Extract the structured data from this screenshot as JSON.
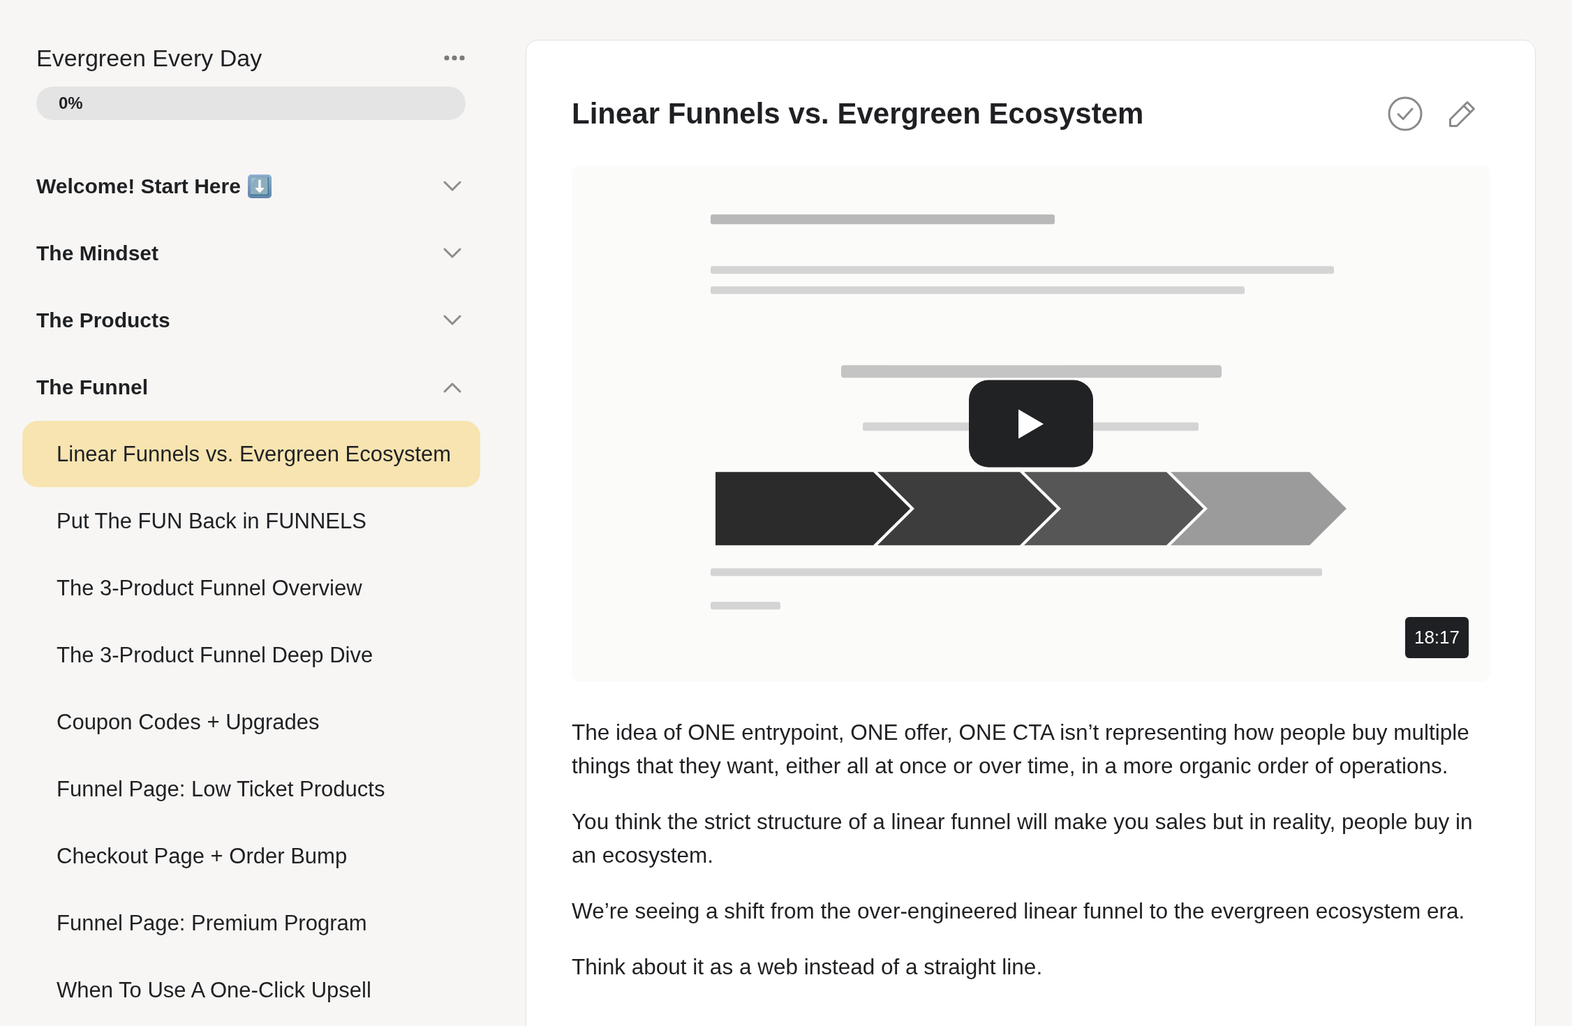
{
  "course": {
    "title": "Evergreen Every Day",
    "progress": {
      "level": 0,
      "reading": "0%"
    }
  },
  "sections": [
    {
      "title": "Welcome! Start Here",
      "emoji": "⬇️",
      "expanded": false
    },
    {
      "title": "The Mindset",
      "expanded": false
    },
    {
      "title": "The Products",
      "expanded": false
    },
    {
      "title": "The Funnel",
      "expanded": true,
      "lessons": [
        {
          "title": "Linear Funnels vs. Evergreen Ecosystem",
          "selected": true
        },
        {
          "title": "Put The FUN Back in FUNNELS",
          "selected": false
        },
        {
          "title": "The 3-Product Funnel Overview",
          "selected": false
        },
        {
          "title": "The 3-Product Funnel Deep Dive",
          "selected": false
        },
        {
          "title": "Coupon Codes + Upgrades",
          "selected": false
        },
        {
          "title": "Funnel Page: Low Ticket Products",
          "selected": false
        },
        {
          "title": "Checkout Page + Order Bump",
          "selected": false
        },
        {
          "title": "Funnel Page: Premium Program",
          "selected": false
        },
        {
          "title": "When To Use A One-Click Upsell",
          "selected": false
        }
      ]
    }
  ],
  "lesson": {
    "title": "Linear Funnels vs. Evergreen Ecosystem",
    "video": {
      "duration": "18:17"
    },
    "paragraphs": [
      "The idea of ONE entrypoint, ONE offer, ONE CTA isn’t representing how people buy multiple things that they want, either all at once or over time, in a more organic order of operations.",
      "You think the strict structure of a linear funnel will make you sales but in reality, people buy in an ecosystem.",
      "We’re seeing a shift from the over-engineered linear funnel to the evergreen ecosystem era.",
      "Think about it as a web instead of a straight line."
    ]
  }
}
